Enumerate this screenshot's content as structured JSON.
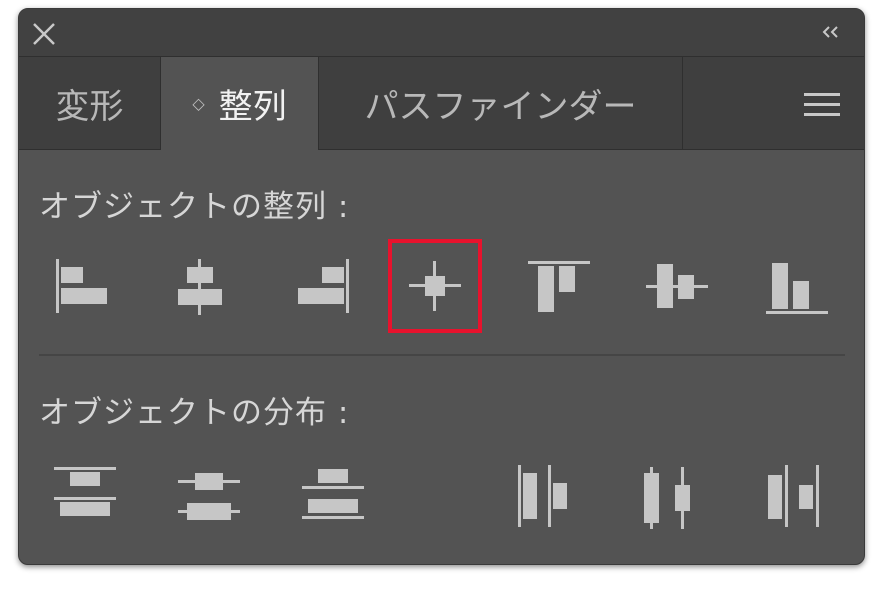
{
  "window": {
    "close_icon": "close-icon",
    "collapse_icon": "double-chevron-left-icon"
  },
  "tabs": {
    "transform": "変形",
    "align": "整列",
    "pathfinder": "パスファインダー",
    "align_updown_icon": "◇",
    "menu_icon": "hamburger-menu-icon"
  },
  "align_section": {
    "label": "オブジェクトの整列 :",
    "buttons": [
      {
        "icon": "align-left-icon"
      },
      {
        "icon": "align-horizontal-center-icon"
      },
      {
        "icon": "align-right-icon"
      },
      {
        "icon": "align-center-icon",
        "highlighted": true
      },
      {
        "icon": "align-top-icon"
      },
      {
        "icon": "align-vertical-center-icon"
      },
      {
        "icon": "align-bottom-icon"
      }
    ]
  },
  "distribute_section": {
    "label": "オブジェクトの分布 :",
    "buttons": [
      {
        "icon": "distribute-top-icon"
      },
      {
        "icon": "distribute-vertical-center-icon"
      },
      {
        "icon": "distribute-bottom-icon"
      },
      {
        "icon": "distribute-left-icon"
      },
      {
        "icon": "distribute-horizontal-center-icon"
      },
      {
        "icon": "distribute-right-icon"
      }
    ]
  },
  "colors": {
    "panel_bg": "#535353",
    "tab_bg": "#3f3f3f",
    "icon": "#c6c6c6",
    "highlight": "#e8122d"
  }
}
